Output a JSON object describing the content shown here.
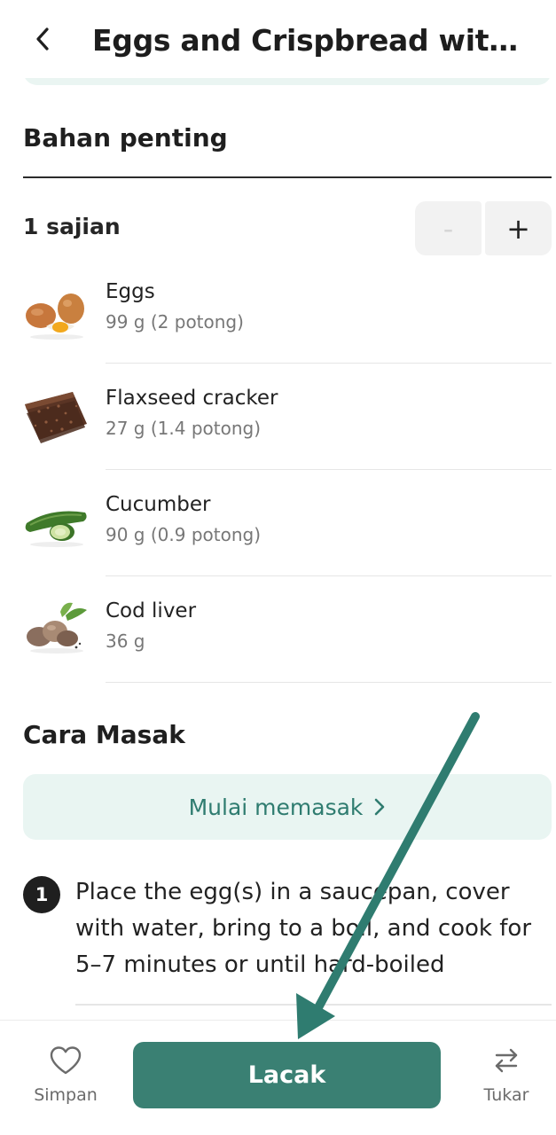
{
  "header": {
    "title": "Eggs and Crispbread with..."
  },
  "ingredients_section": {
    "title": "Bahan penting",
    "servings_label": "1 sajian",
    "minus_label": "-",
    "plus_label": "+",
    "items": [
      {
        "name": "Eggs",
        "amount": "99 g (2 potong)",
        "icon": "eggs-image"
      },
      {
        "name": "Flaxseed cracker",
        "amount": "27 g (1.4 potong)",
        "icon": "flaxseed-cracker-image"
      },
      {
        "name": "Cucumber",
        "amount": "90 g (0.9 potong)",
        "icon": "cucumber-image"
      },
      {
        "name": "Cod liver",
        "amount": "36 g",
        "icon": "cod-liver-image"
      }
    ]
  },
  "cooking_section": {
    "title": "Cara Masak",
    "start_label": "Mulai memasak",
    "steps": [
      {
        "number": "1",
        "text": "Place the egg(s) in a saucepan, cover with water, bring to a boil, and cook for 5–7 minutes or until hard-boiled"
      }
    ]
  },
  "bottom_bar": {
    "save_label": "Simpan",
    "track_label": "Lacak",
    "swap_label": "Tukar"
  },
  "colors": {
    "accent": "#3a8073",
    "accent_light": "#e9f5f2",
    "annotation_arrow": "#2f7c70"
  }
}
